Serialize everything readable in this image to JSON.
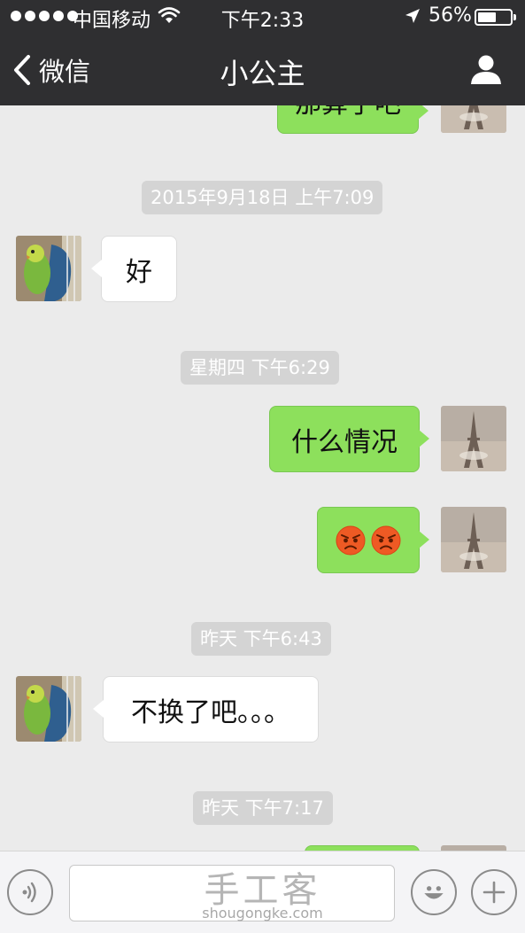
{
  "status_bar": {
    "carrier": "中国移动",
    "time": "下午2:33",
    "battery": "56%",
    "battery_level": 0.56
  },
  "nav": {
    "back_label": "微信",
    "title": "小公主"
  },
  "messages": {
    "partial_top": "那算了吧",
    "ts1": "2015年9月18日 上午7:09",
    "m1": "好",
    "ts2": "星期四 下午6:29",
    "m2": "什么情况",
    "ts3": "昨天 下午6:43",
    "m4": "不换了吧。。。",
    "ts4": "昨天 下午7:17"
  },
  "watermark": {
    "main": "手工客",
    "sub": "shougongke.com"
  },
  "colors": {
    "header_bg": "#2f2f31",
    "chat_bg": "#ebebeb",
    "outgoing_bubble": "#8de05c",
    "incoming_bubble": "#ffffff",
    "timestamp_bg": "#d4d4d4"
  },
  "icons": [
    "back-chevron-icon",
    "profile-icon",
    "angry-face-emoji",
    "voice-icon",
    "emoji-icon",
    "plus-icon",
    "wifi-icon",
    "location-arrow-icon",
    "battery-icon"
  ]
}
